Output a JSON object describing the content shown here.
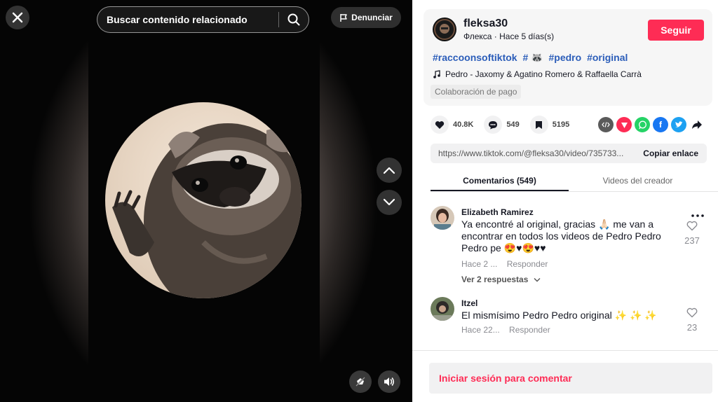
{
  "video": {
    "search_placeholder": "Buscar contenido relacionado",
    "report_label": "Denunciar"
  },
  "post": {
    "username": "fleksa30",
    "subtitle": "Флекса · Hace 5 días(s)",
    "follow_label": "Seguir",
    "tags": [
      "#raccoonsoftiktok",
      "# 🦝",
      "#pedro",
      "#original"
    ],
    "music": "Pedro - Jaxomy & Agatino Romero & Raffaella Carrà",
    "paid_badge": "Colaboración de pago",
    "likes": "40.8K",
    "comments": "549",
    "saves": "5195",
    "link": "https://www.tiktok.com/@fleksa30/video/735733...",
    "copy_label": "Copiar enlace",
    "colors": {
      "accent": "#fe2c55",
      "hashtag": "#2b5db9"
    }
  },
  "tabs": [
    {
      "label": "Comentarios (549)"
    },
    {
      "label": "Videos del creador"
    }
  ],
  "comments": [
    {
      "name": "Elizabeth Ramirez",
      "text": "Ya encontré al original, gracias 🙏🏻 me van a encontrar en todos los videos de Pedro Pedro Pedro pe 😍♥😍♥♥",
      "time": "Hace 2 ...",
      "reply": "Responder",
      "likes": "237",
      "replies": "Ver 2 respuestas"
    },
    {
      "name": "Itzel",
      "text": "El mismísimo Pedro Pedro original ✨ ✨ ✨",
      "time": "Hace 22...",
      "reply": "Responder",
      "likes": "23"
    }
  ],
  "login_label": "Iniciar sesión para comentar"
}
